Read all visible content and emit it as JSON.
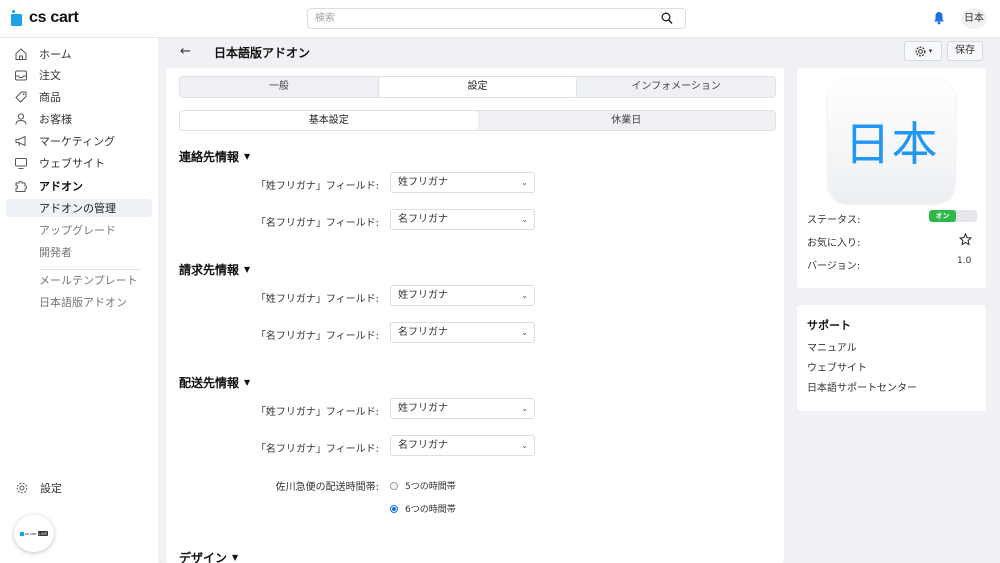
{
  "brand": {
    "logo_text": "cs cart",
    "accent": "#1aa3e8"
  },
  "search": {
    "placeholder": "検索",
    "icon": "search-icon"
  },
  "header": {
    "lang_label": "日本",
    "bell_color": "#1d6fe0"
  },
  "sidebar": {
    "items": [
      {
        "label": "ホーム",
        "icon": "home-icon"
      },
      {
        "label": "注文",
        "icon": "inbox-icon"
      },
      {
        "label": "商品",
        "icon": "tag-icon"
      },
      {
        "label": "お客様",
        "icon": "user-icon"
      },
      {
        "label": "マーケティング",
        "icon": "megaphone-icon"
      },
      {
        "label": "ウェブサイト",
        "icon": "monitor-icon"
      },
      {
        "label": "アドオン",
        "icon": "puzzle-icon"
      }
    ],
    "sub_items": [
      "アドオンの管理",
      "アップグレード",
      "開発者",
      "メールテンプレート",
      "日本語版アドオン"
    ],
    "settings_label": "設定",
    "badge_text": "cs cart",
    "badge_pill": "LIVE"
  },
  "page": {
    "title": "日本語版アドオン",
    "save_label": "保存",
    "tabs": [
      "一般",
      "設定",
      "インフォメーション"
    ],
    "subtabs": [
      "基本設定",
      "休業日"
    ]
  },
  "sections": [
    {
      "title": "連絡先情報",
      "fields": [
        {
          "label": "「姓フリガナ」フィールド:",
          "value": "姓フリガナ"
        },
        {
          "label": "「名フリガナ」フィールド:",
          "value": "名フリガナ"
        }
      ]
    },
    {
      "title": "請求先情報",
      "fields": [
        {
          "label": "「姓フリガナ」フィールド:",
          "value": "姓フリガナ"
        },
        {
          "label": "「名フリガナ」フィールド:",
          "value": "名フリガナ"
        }
      ]
    },
    {
      "title": "配送先情報",
      "fields": [
        {
          "label": "「姓フリガナ」フィールド:",
          "value": "姓フリガナ"
        },
        {
          "label": "「名フリガナ」フィールド:",
          "value": "名フリガナ"
        }
      ],
      "radio_label": "佐川急便の配送時間帯:",
      "radio_options": [
        "5つの時間帯",
        "6つの時間帯"
      ],
      "radio_selected": 1
    },
    {
      "title": "デザイン"
    }
  ],
  "addon_card": {
    "icon_text": "日本",
    "icon_color": "#2196f3",
    "status_label": "ステータス:",
    "status_value": "オン",
    "status_color": "#2fb84a",
    "favorite_label": "お気に入り:",
    "version_label": "バージョン:",
    "version_value": "1.0"
  },
  "support": {
    "title": "サポート",
    "links": [
      "マニュアル",
      "ウェブサイト",
      "日本語サポートセンター"
    ]
  }
}
